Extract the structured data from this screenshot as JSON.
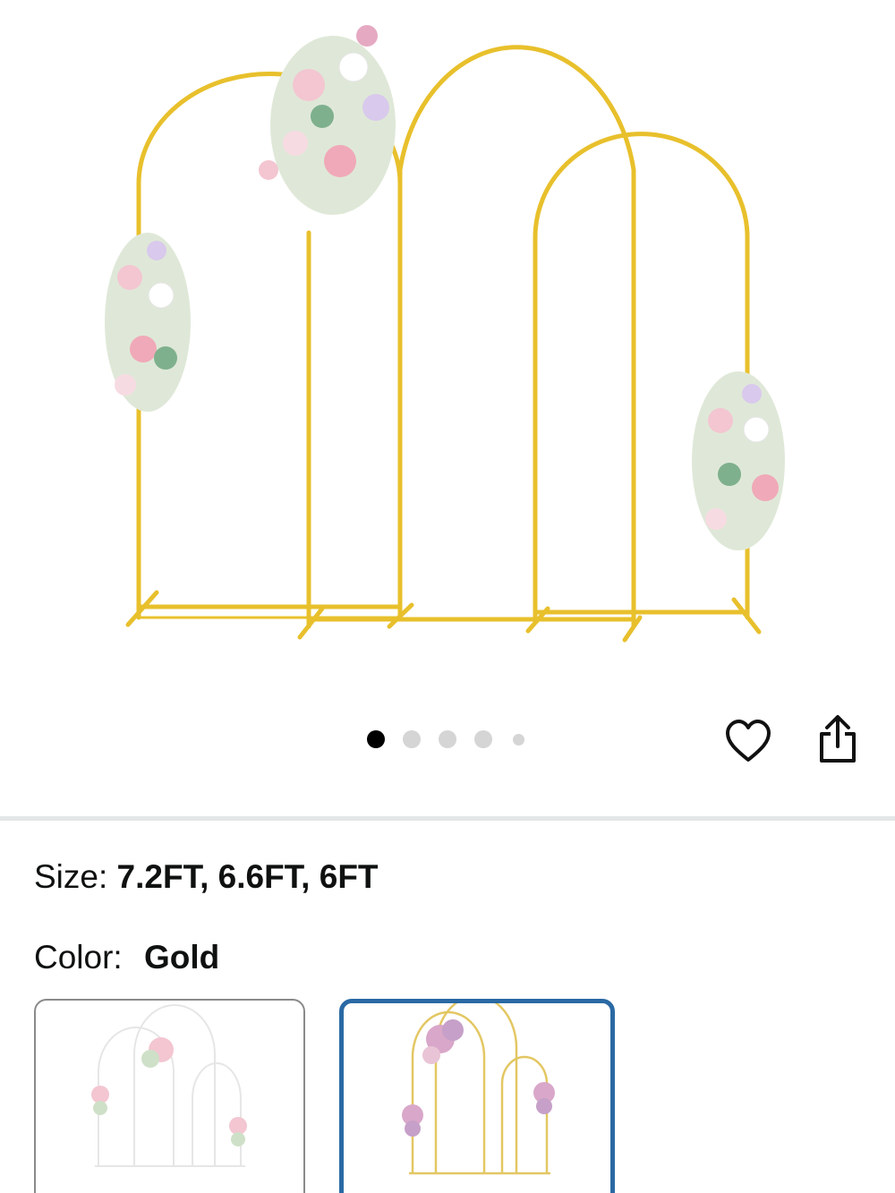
{
  "product": {
    "hero_image": {
      "icon": "arch-backdrop-photo",
      "frame_color": "#e8c02c"
    },
    "carousel": {
      "total_images": 5,
      "active_index": 0
    },
    "actions": {
      "wishlist_icon": "heart-icon",
      "share_icon": "share-icon"
    }
  },
  "variations": {
    "size": {
      "label": "Size:",
      "value": "7.2FT, 6.6FT, 6FT"
    },
    "color": {
      "label": "Color:",
      "value": "Gold",
      "options": [
        {
          "icon": "white-arch-thumbnail",
          "frame_color": "#eeeeee",
          "selected": false
        },
        {
          "icon": "gold-arch-thumbnail",
          "frame_color": "#e3c763",
          "selected": true
        }
      ],
      "selected_border_color": "#2a69a4"
    }
  }
}
